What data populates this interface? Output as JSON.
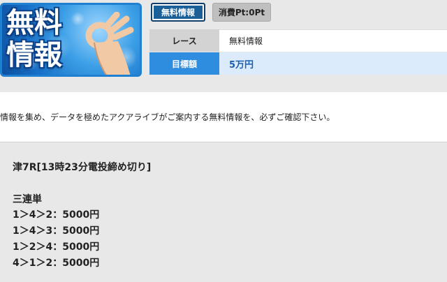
{
  "header": {
    "thumbnail": {
      "title_top": "無料",
      "title_bottom": "情報",
      "icon": "ok-hand-icon"
    },
    "tabs": [
      {
        "label": "無料情報",
        "active": true
      },
      {
        "label": "消費Pt:0Pt",
        "active": false
      }
    ]
  },
  "info": {
    "race_label": "レース",
    "race_value": "無料情報",
    "target_label": "目標額",
    "target_value": "5万円"
  },
  "description": "情報を集め、データを極めたアクアライブがご案内する無料情報を、必ずご確認下さい。",
  "prediction": {
    "race_title": "津7R[13時23分電投締め切り]",
    "bet_type": "三連単",
    "picks": [
      "1＞4＞2：5000円",
      "1＞4＞3：5000円",
      "1＞2＞4：5000円",
      "4＞1＞2：5000円"
    ]
  },
  "colors": {
    "accent": "#2f8de0",
    "tab_active": "#1a5f98",
    "target_bg": "#dcebfb",
    "target_text": "#1a5fb0"
  }
}
